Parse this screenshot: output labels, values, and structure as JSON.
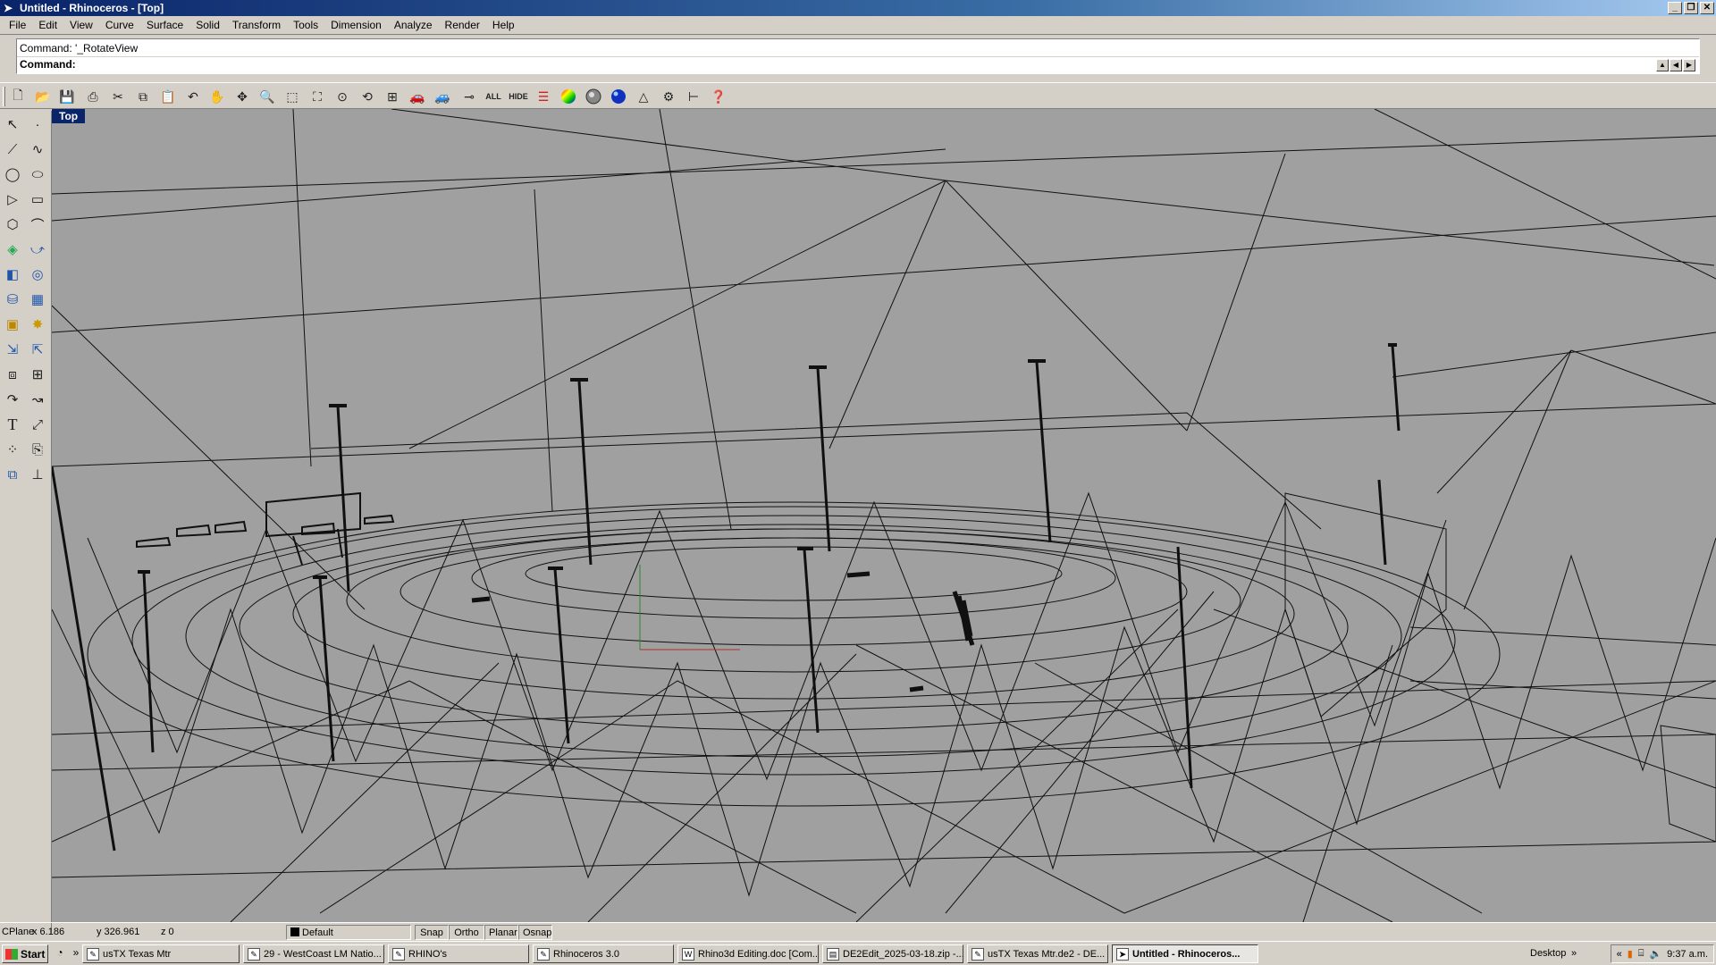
{
  "window": {
    "title": "Untitled - Rhinoceros - [Top]",
    "controls": [
      "_",
      "❐",
      "✕"
    ]
  },
  "menu": [
    "File",
    "Edit",
    "View",
    "Curve",
    "Surface",
    "Solid",
    "Transform",
    "Tools",
    "Dimension",
    "Analyze",
    "Render",
    "Help"
  ],
  "command": {
    "history": "Command: '_RotateView",
    "prompt": "Command:"
  },
  "toolbar": {
    "icons": [
      "new-file-icon",
      "open-file-icon",
      "save-icon",
      "print-icon",
      "cut-icon",
      "copy-icon",
      "paste-icon",
      "undo-icon",
      "pan-hand-icon",
      "rotate-view-icon",
      "zoom-dynamic-icon",
      "zoom-window-icon",
      "zoom-extents-icon",
      "zoom-selected-icon",
      "undo-view-icon",
      "four-viewports-icon",
      "car-object-icon",
      "car-wire-icon",
      "show-icon",
      "show-all-icon",
      "hide-icon",
      "layers-icon",
      "color-wheel-icon",
      "shade-icon",
      "render-icon",
      "light-icon",
      "options-icon",
      "dimension-icon",
      "help-icon"
    ],
    "all_label": "ALL",
    "hide_label": "HIDE"
  },
  "sidebar": {
    "tools": [
      "select-icon",
      "point-icon",
      "polyline-icon",
      "curve-icon",
      "circle-icon",
      "ellipse-icon",
      "polygon-icon",
      "rectangle-icon",
      "gear-polygon-icon",
      "arc-icon",
      "surface-icon",
      "sweep-icon",
      "box-icon",
      "boolean-icon",
      "cylinder-icon",
      "loft-icon",
      "bump-icon",
      "explode-icon",
      "extrude-icon",
      "trim-icon",
      "group-icon",
      "array-icon",
      "fillet-icon",
      "chamfer-icon",
      "text-icon",
      "scale-icon",
      "grid-snap-icon",
      "orient-icon",
      "named-view-icon",
      "dim-tool-icon"
    ],
    "text_tool_glyph": "T"
  },
  "viewport": {
    "label": "Top"
  },
  "status": {
    "cplane": "CPlane",
    "x": "x 6.186",
    "y": "y 326.961",
    "z": "z 0",
    "layer": "Default",
    "snap": "Snap",
    "ortho": "Ortho",
    "planar": "Planar",
    "osnap": "Osnap"
  },
  "taskbar": {
    "start": "Start",
    "overflow": "»",
    "tasks": [
      "usTX Texas Mtr",
      "29 - WestCoast LM Natio...",
      "RHINO's",
      "Rhinoceros 3.0",
      "Rhino3d Editing.doc [Com...",
      "DE2Edit_2025-03-18.zip -...",
      "usTX Texas Mtr.de2 - DE...",
      "Untitled - Rhinoceros..."
    ],
    "desktop_label": "Desktop",
    "desktop_overflow": "»",
    "tray_arrow": "«",
    "clock": "9:37 a.m."
  },
  "colors": {
    "titlebar": "#0a246a",
    "viewport_bg": "#a0a0a0",
    "chrome": "#d4d0c8",
    "wire": "#101010"
  }
}
